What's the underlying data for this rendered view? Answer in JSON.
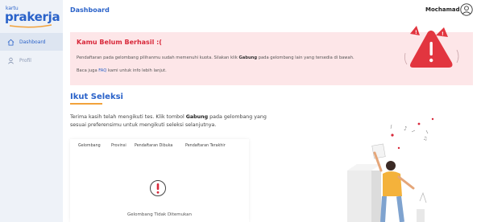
{
  "brand": {
    "small": "kartu",
    "main": "prakerja"
  },
  "sidebar": {
    "items": [
      {
        "label": "Dashboard",
        "icon": "home-icon",
        "active": true
      },
      {
        "label": "Profil",
        "icon": "user-icon",
        "active": false
      }
    ]
  },
  "header": {
    "title": "Dashboard",
    "username": "Mochamad"
  },
  "alert": {
    "title": "Kamu Belum Berhasil :(",
    "line1_pre": "Pendaftaran pada gelombang pilihanmu sudah memenuhi kuota. Silakan klik ",
    "line1_bold": "Gabung",
    "line1_post": " pada gelombang lain yang tersedia di bawah.",
    "line2_pre": "Baca juga ",
    "line2_link": "FAQ",
    "line2_post": " kami untuk info lebih lanjut."
  },
  "section": {
    "title": "Ikut Seleksi",
    "desc_pre": "Terima kasih telah mengikuti tes. Klik tombol ",
    "desc_bold": "Gabung",
    "desc_post": " pada gelombang yang sesuai preferensimu untuk mengikuti seleksi selanjutnya."
  },
  "table": {
    "columns": [
      "Gelombang",
      "Provinsi",
      "Pendaftaran Dibuka",
      "Pendaftaran Terakhir"
    ],
    "empty_text": "Gelombang Tidak Ditemukan"
  },
  "colors": {
    "accent": "#2a62c9",
    "danger": "#d8283a",
    "alert_bg": "#fde6e8",
    "underline": "#f2a23b",
    "sidebar_bg": "#eef2f8"
  }
}
